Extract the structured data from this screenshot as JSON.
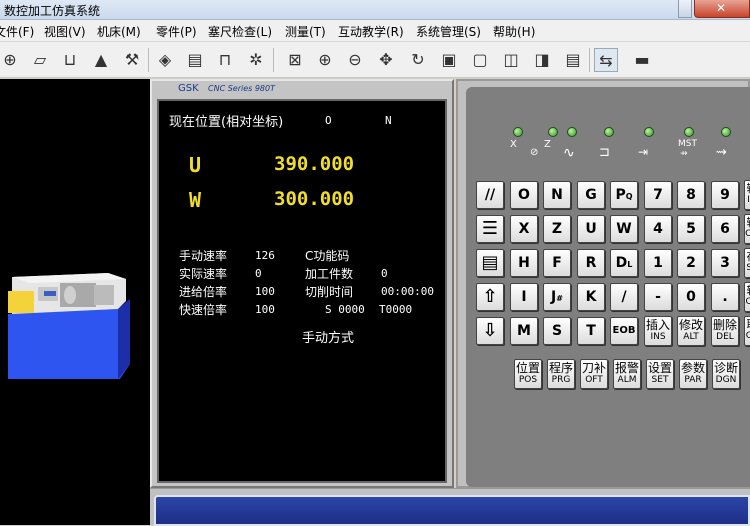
{
  "window": {
    "title": "数控加工仿真系统"
  },
  "menu": [
    "文件(F)",
    "视图(V)",
    "机床(M)",
    "零件(P)",
    "塞尺检查(L)",
    "测量(T)",
    "互动教学(R)",
    "系统管理(S)",
    "帮助(H)"
  ],
  "toolbar_icons": [
    "reference-icon",
    "workpiece-icon",
    "fixture-icon",
    "tool-setting-icon",
    "tool-icon",
    "chuck-icon",
    "load-part-icon",
    "measure-icon",
    "coolant-icon",
    "zoom-region-icon",
    "zoom-in-icon",
    "zoom-out-icon",
    "pan-icon",
    "rotate-icon",
    "view-front-icon",
    "view-top-icon",
    "view-left-icon",
    "view-right-icon",
    "control-panel-icon",
    "switch-icon",
    "cnc-panel-icon"
  ],
  "cnc": {
    "brand": "GSK",
    "series": "CNC Series 980T",
    "screen_title": "现在位置(相对坐标)",
    "screen_o": "O",
    "screen_n": "N",
    "axes": [
      {
        "label": "U",
        "value": "390.000"
      },
      {
        "label": "W",
        "value": "300.000"
      }
    ],
    "status": {
      "manual_rate_label": "手动速率",
      "manual_rate": "126",
      "actual_rate_label": "实际速率",
      "actual_rate": "0",
      "feed_override_label": "进给倍率",
      "feed_override": "100",
      "rapid_override_label": "快速倍率",
      "rapid_override": "100",
      "c_func_label": "C功能码",
      "parts_label": "加工件数",
      "parts": "0",
      "cut_time_label": "切削时间",
      "cut_time": "00:00:00",
      "s_code": "S 0000",
      "t_code": "T0000",
      "mode": "手动方式"
    }
  },
  "panel": {
    "led_labels": [
      "X",
      "Z",
      "MST"
    ],
    "rows": [
      [
        "//",
        "O",
        "N",
        "G",
        "PQ",
        "7",
        "8",
        "9"
      ],
      [
        "EDIT",
        "X",
        "Z",
        "U",
        "W",
        "4",
        "5",
        "6"
      ],
      [
        "MEM",
        "H",
        "F",
        "R",
        "DL",
        "1",
        "2",
        "3"
      ],
      [
        "UP",
        "I",
        "J#",
        "K",
        "/",
        "-",
        "0",
        "."
      ],
      [
        "DOWN",
        "M",
        "S",
        "T",
        "EOB"
      ]
    ],
    "side_keys": [
      {
        "main": "输",
        "sub": "IN"
      },
      {
        "main": "输",
        "sub": "OU"
      },
      {
        "main": "存",
        "sub": "ST"
      },
      {
        "main": "转",
        "sub": "CH"
      },
      {
        "main": "取",
        "sub": "CA"
      }
    ],
    "edit_keys": [
      {
        "main": "插入",
        "sub": "INS"
      },
      {
        "main": "修改",
        "sub": "ALT"
      },
      {
        "main": "删除",
        "sub": "DEL"
      }
    ],
    "function_keys": [
      {
        "main": "位置",
        "sub": "POS"
      },
      {
        "main": "程序",
        "sub": "PRG"
      },
      {
        "main": "刀补",
        "sub": "OFT"
      },
      {
        "main": "报警",
        "sub": "ALM"
      },
      {
        "main": "设置",
        "sub": "SET"
      },
      {
        "main": "参数",
        "sub": "PAR"
      },
      {
        "main": "诊断",
        "sub": "DGN"
      }
    ]
  },
  "colors": {
    "screen_bg": "#000000",
    "axis_yellow": "#f1de28",
    "panel_grey": "#7f7f7f",
    "led_green": "#3b8f2a"
  }
}
